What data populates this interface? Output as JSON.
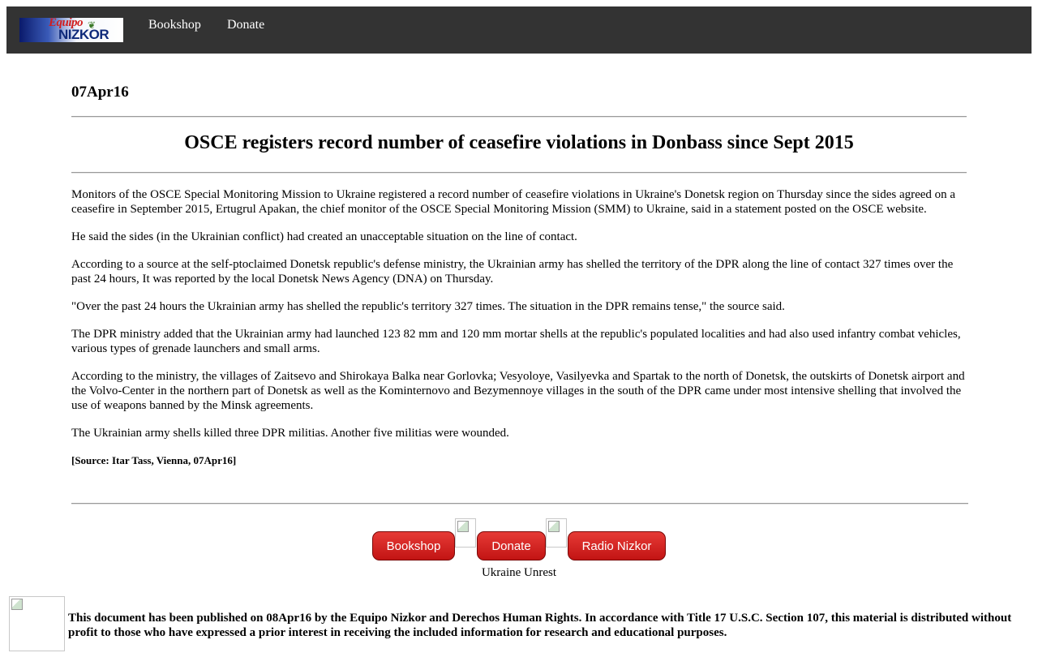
{
  "header": {
    "logo": {
      "top_text": "Equipo",
      "bottom_text": "NIZKOR"
    },
    "nav": [
      {
        "label": "Bookshop"
      },
      {
        "label": "Donate"
      }
    ]
  },
  "article": {
    "date": "07Apr16",
    "title": "OSCE registers record number of ceasefire violations in Donbass since Sept 2015",
    "paragraphs": [
      "Monitors of the OSCE Special Monitoring Mission to Ukraine registered a record number of ceasefire violations in Ukraine's Donetsk region on Thursday since the sides agreed on a ceasefire in September 2015, Ertugrul Apakan, the chief monitor of the OSCE Special Monitoring Mission (SMM) to Ukraine, said in a statement posted on the OSCE website.",
      "He said the sides (in the Ukrainian conflict) had created an unacceptable situation on the line of contact.",
      "According to a source at the self-ptoclaimed Donetsk republic's defense ministry, the Ukrainian army has shelled the territory of the DPR along the line of contact 327 times over the past 24 hours, It was reported by the local Donetsk News Agency (DNA) on Thursday.",
      "\"Over the past 24 hours the Ukrainian army has shelled the republic's territory 327 times. The situation in the DPR remains tense,\" the source said.",
      "The DPR ministry added that the Ukrainian army had launched 123 82 mm and 120 mm mortar shells at the republic's populated localities and had also used infantry combat vehicles, various types of grenade launchers and small arms.",
      "According to the ministry, the villages of Zaitsevo and Shirokaya Balka near Gorlovka; Vesyoloye, Vasilyevka and Spartak to the north of Donetsk, the outskirts of Donetsk airport and the Volvo-Center in the northern part of Donetsk as well as the Kominternovo and Bezymennoye villages in the south of the DPR came under most intensive shelling that involved the use of weapons banned by the Minsk agreements.",
      "The Ukrainian army shells killed three DPR militias. Another five militias were wounded."
    ],
    "source": "[Source: Itar Tass, Vienna, 07Apr16]"
  },
  "bottom_nav": {
    "buttons": [
      {
        "label": "Bookshop"
      },
      {
        "label": "Donate"
      },
      {
        "label": "Radio Nizkor"
      }
    ],
    "caption": "Ukraine Unrest"
  },
  "footer": {
    "text": "This document has been published on 08Apr16 by the Equipo Nizkor and Derechos Human Rights. In accordance with Title 17 U.S.C. Section 107, this material is distributed without profit to those who have expressed a prior interest in receiving the included information for research and educational purposes."
  }
}
